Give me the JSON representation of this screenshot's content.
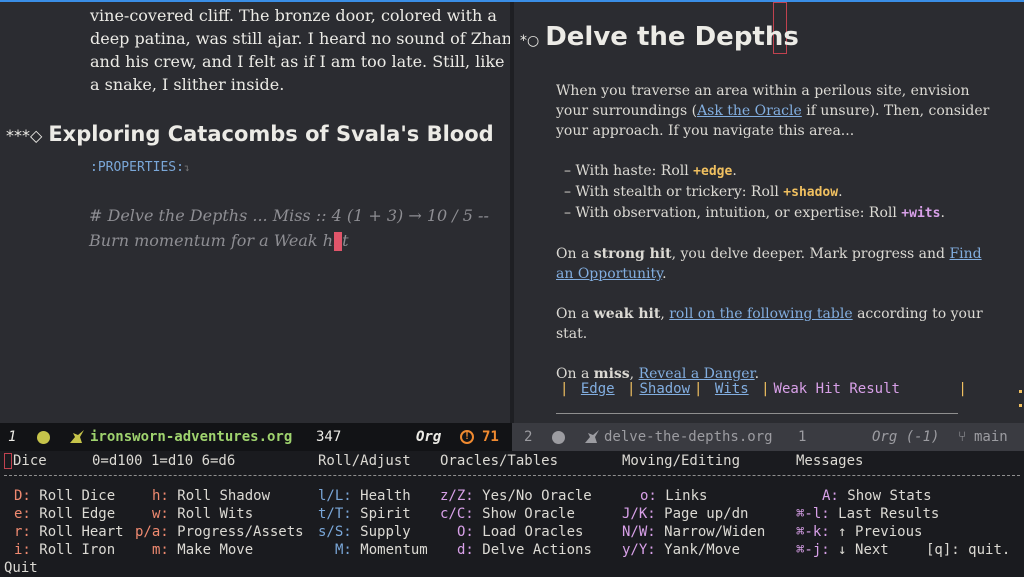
{
  "left_buffer": {
    "story_lines": [
      "vine-covered cliff. The bronze door, colored with a",
      "deep patina, was still ajar. I heard no sound of Zhan",
      "and his crew, and I felt as if I am too late. Still, like",
      "a snake, I slither inside."
    ],
    "heading_stars": "***◇",
    "heading": "Exploring Catacombs of Svala's Blood",
    "properties": ":PROPERTIES:",
    "properties_arrow": "↴",
    "comment_line1": "# Delve the Depths ... Miss :: 4 (1 + 3) → 10 / 5 --",
    "comment_line2_before": "Burn momentum for a Weak hi",
    "comment_line2_after": "t"
  },
  "right_buffer": {
    "heading_star": "*○",
    "title": "Delve the Depths",
    "para1_a": "When you traverse an area within a perilous site, envision your surroundings (",
    "para1_link": "Ask the Oracle",
    "para1_b": " if unsure). Then, consider your approach. If you navigate this area...",
    "items": [
      {
        "text": "– With haste: Roll ",
        "kw": "+edge",
        "end": "."
      },
      {
        "text": "– With stealth or trickery: Roll ",
        "kw": "+shadow",
        "end": "."
      },
      {
        "text": "– With observation, intuition, or expertise: Roll ",
        "kw": "+wits",
        "end": "."
      }
    ],
    "strong_a": "On a ",
    "strong_b": "strong hit",
    "strong_c": ", you delve deeper. Mark progress and ",
    "strong_link": "Find an Opportunity",
    "strong_end": ".",
    "weak_a": "On a ",
    "weak_b": "weak hit",
    "weak_c": ", ",
    "weak_link": "roll on the following table",
    "weak_d": " according to your stat.",
    "miss_a": "On a ",
    "miss_b": "miss",
    "miss_c": ", ",
    "miss_link": "Reveal a Danger",
    "miss_end": ".",
    "table_headers": [
      "Edge",
      "Shadow",
      "Wits",
      "Weak Hit Result"
    ]
  },
  "modeline_left": {
    "window_num": "1",
    "buffer": "ironsworn-adventures.org",
    "line": "347",
    "mode": "Org",
    "warnings": "71"
  },
  "modeline_right": {
    "window_num": "2",
    "buffer": "delve-the-depths.org",
    "line": "1",
    "mode": "Org (-1)",
    "branch": "main"
  },
  "hydra": {
    "headers": [
      "Dice",
      "0=d100 1=d10 6=d6",
      "Roll/Adjust",
      "Oracles/Tables",
      "Moving/Editing",
      "Messages"
    ],
    "rows": [
      [
        {
          "k": "D:",
          "l": "Roll Dice"
        },
        {
          "k": "h:",
          "l": "Roll Shadow"
        },
        {
          "k": "l/L:",
          "l": "Health"
        },
        {
          "k": "z/Z:",
          "l": "Yes/No Oracle"
        },
        {
          "k": "o:",
          "l": "Links"
        },
        {
          "k": "A:",
          "l": "Show Stats"
        }
      ],
      [
        {
          "k": "e:",
          "l": "Roll Edge"
        },
        {
          "k": "w:",
          "l": "Roll Wits"
        },
        {
          "k": "t/T:",
          "l": "Spirit"
        },
        {
          "k": "c/C:",
          "l": "Show Oracle"
        },
        {
          "k": "J/K:",
          "l": "Page up/dn"
        },
        {
          "k": "⌘-l:",
          "l": "Last Results"
        }
      ],
      [
        {
          "k": "r:",
          "l": "Roll Heart"
        },
        {
          "k": "p/a:",
          "l": "Progress/Assets"
        },
        {
          "k": "s/S:",
          "l": "Supply"
        },
        {
          "k": "O:",
          "l": "Load Oracles"
        },
        {
          "k": "N/W:",
          "l": "Narrow/Widen"
        },
        {
          "k": "⌘-k:",
          "l": "↑ Previous"
        }
      ],
      [
        {
          "k": "i:",
          "l": "Roll Iron"
        },
        {
          "k": "m:",
          "l": "Make Move"
        },
        {
          "k": "M:",
          "l": "Momentum"
        },
        {
          "k": "d:",
          "l": "Delve Actions"
        },
        {
          "k": "y/Y:",
          "l": "Yank/Move"
        },
        {
          "k": "⌘-j:",
          "l": "↓ Next"
        }
      ]
    ],
    "quit_key": "[q]:",
    "quit_label": "quit.",
    "footer": "Quit"
  },
  "colors": {
    "accent": "#3a8ee6",
    "keyword": "#f0c060",
    "link": "#82aee0",
    "hydra_key": "#f08a70",
    "modeline_dot_active": "#c6c44a",
    "warning": "#f08a30"
  }
}
